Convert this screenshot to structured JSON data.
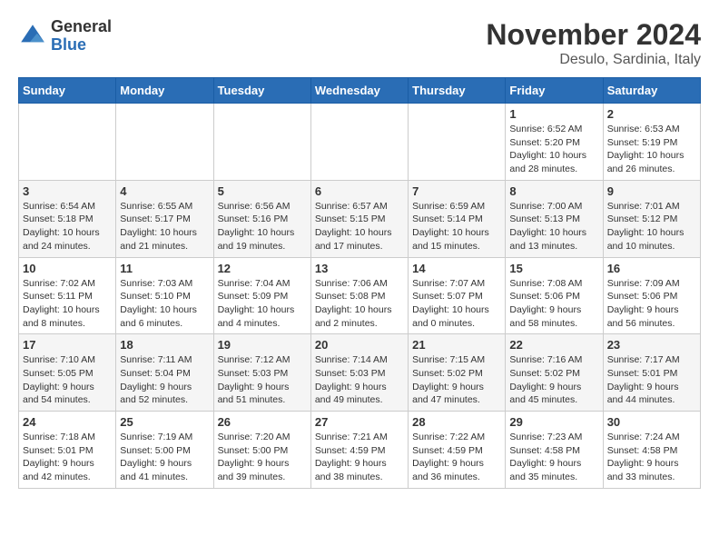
{
  "logo": {
    "general": "General",
    "blue": "Blue"
  },
  "title": "November 2024",
  "location": "Desulo, Sardinia, Italy",
  "days_of_week": [
    "Sunday",
    "Monday",
    "Tuesday",
    "Wednesday",
    "Thursday",
    "Friday",
    "Saturday"
  ],
  "weeks": [
    [
      {
        "day": "",
        "info": ""
      },
      {
        "day": "",
        "info": ""
      },
      {
        "day": "",
        "info": ""
      },
      {
        "day": "",
        "info": ""
      },
      {
        "day": "",
        "info": ""
      },
      {
        "day": "1",
        "info": "Sunrise: 6:52 AM\nSunset: 5:20 PM\nDaylight: 10 hours and 28 minutes."
      },
      {
        "day": "2",
        "info": "Sunrise: 6:53 AM\nSunset: 5:19 PM\nDaylight: 10 hours and 26 minutes."
      }
    ],
    [
      {
        "day": "3",
        "info": "Sunrise: 6:54 AM\nSunset: 5:18 PM\nDaylight: 10 hours and 24 minutes."
      },
      {
        "day": "4",
        "info": "Sunrise: 6:55 AM\nSunset: 5:17 PM\nDaylight: 10 hours and 21 minutes."
      },
      {
        "day": "5",
        "info": "Sunrise: 6:56 AM\nSunset: 5:16 PM\nDaylight: 10 hours and 19 minutes."
      },
      {
        "day": "6",
        "info": "Sunrise: 6:57 AM\nSunset: 5:15 PM\nDaylight: 10 hours and 17 minutes."
      },
      {
        "day": "7",
        "info": "Sunrise: 6:59 AM\nSunset: 5:14 PM\nDaylight: 10 hours and 15 minutes."
      },
      {
        "day": "8",
        "info": "Sunrise: 7:00 AM\nSunset: 5:13 PM\nDaylight: 10 hours and 13 minutes."
      },
      {
        "day": "9",
        "info": "Sunrise: 7:01 AM\nSunset: 5:12 PM\nDaylight: 10 hours and 10 minutes."
      }
    ],
    [
      {
        "day": "10",
        "info": "Sunrise: 7:02 AM\nSunset: 5:11 PM\nDaylight: 10 hours and 8 minutes."
      },
      {
        "day": "11",
        "info": "Sunrise: 7:03 AM\nSunset: 5:10 PM\nDaylight: 10 hours and 6 minutes."
      },
      {
        "day": "12",
        "info": "Sunrise: 7:04 AM\nSunset: 5:09 PM\nDaylight: 10 hours and 4 minutes."
      },
      {
        "day": "13",
        "info": "Sunrise: 7:06 AM\nSunset: 5:08 PM\nDaylight: 10 hours and 2 minutes."
      },
      {
        "day": "14",
        "info": "Sunrise: 7:07 AM\nSunset: 5:07 PM\nDaylight: 10 hours and 0 minutes."
      },
      {
        "day": "15",
        "info": "Sunrise: 7:08 AM\nSunset: 5:06 PM\nDaylight: 9 hours and 58 minutes."
      },
      {
        "day": "16",
        "info": "Sunrise: 7:09 AM\nSunset: 5:06 PM\nDaylight: 9 hours and 56 minutes."
      }
    ],
    [
      {
        "day": "17",
        "info": "Sunrise: 7:10 AM\nSunset: 5:05 PM\nDaylight: 9 hours and 54 minutes."
      },
      {
        "day": "18",
        "info": "Sunrise: 7:11 AM\nSunset: 5:04 PM\nDaylight: 9 hours and 52 minutes."
      },
      {
        "day": "19",
        "info": "Sunrise: 7:12 AM\nSunset: 5:03 PM\nDaylight: 9 hours and 51 minutes."
      },
      {
        "day": "20",
        "info": "Sunrise: 7:14 AM\nSunset: 5:03 PM\nDaylight: 9 hours and 49 minutes."
      },
      {
        "day": "21",
        "info": "Sunrise: 7:15 AM\nSunset: 5:02 PM\nDaylight: 9 hours and 47 minutes."
      },
      {
        "day": "22",
        "info": "Sunrise: 7:16 AM\nSunset: 5:02 PM\nDaylight: 9 hours and 45 minutes."
      },
      {
        "day": "23",
        "info": "Sunrise: 7:17 AM\nSunset: 5:01 PM\nDaylight: 9 hours and 44 minutes."
      }
    ],
    [
      {
        "day": "24",
        "info": "Sunrise: 7:18 AM\nSunset: 5:01 PM\nDaylight: 9 hours and 42 minutes."
      },
      {
        "day": "25",
        "info": "Sunrise: 7:19 AM\nSunset: 5:00 PM\nDaylight: 9 hours and 41 minutes."
      },
      {
        "day": "26",
        "info": "Sunrise: 7:20 AM\nSunset: 5:00 PM\nDaylight: 9 hours and 39 minutes."
      },
      {
        "day": "27",
        "info": "Sunrise: 7:21 AM\nSunset: 4:59 PM\nDaylight: 9 hours and 38 minutes."
      },
      {
        "day": "28",
        "info": "Sunrise: 7:22 AM\nSunset: 4:59 PM\nDaylight: 9 hours and 36 minutes."
      },
      {
        "day": "29",
        "info": "Sunrise: 7:23 AM\nSunset: 4:58 PM\nDaylight: 9 hours and 35 minutes."
      },
      {
        "day": "30",
        "info": "Sunrise: 7:24 AM\nSunset: 4:58 PM\nDaylight: 9 hours and 33 minutes."
      }
    ]
  ]
}
